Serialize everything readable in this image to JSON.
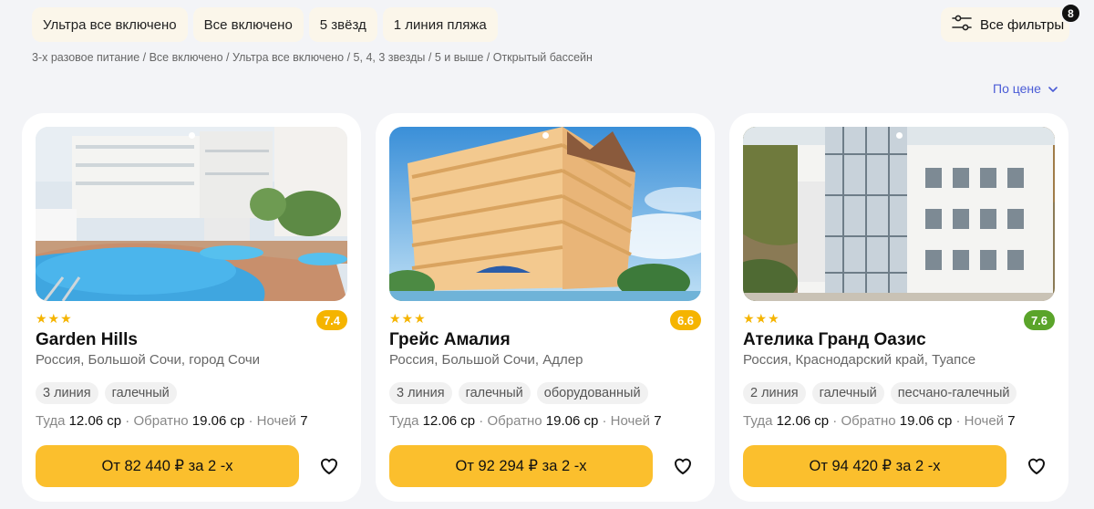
{
  "chips": [
    "Ультра все включено",
    "Все включено",
    "5 звёзд",
    "1 линия пляжа"
  ],
  "filters": {
    "label": "Все фильтры",
    "count": "8"
  },
  "breadcrumb": "3-х разовое питание / Все включено / Ультра все включено / 5, 4, 3 звезды / 5 и выше / Открытый бассейн",
  "sort": {
    "label": "По цене"
  },
  "dates_labels": {
    "there": "Туда",
    "back": "Обратно",
    "nights": "Ночей",
    "sep": " · "
  },
  "colors": {
    "accent": "#fbbf2d",
    "star": "#f5b400",
    "link": "#4a5bd6"
  },
  "hotels": [
    {
      "stars": "★★★",
      "rating": "7.4",
      "rating_color": "#f5b400",
      "name": "Garden Hills",
      "location": "Россия, Большой Сочи, город Сочи",
      "tags": [
        "3 линия",
        "галечный"
      ],
      "date_there": "12.06 ср",
      "date_back": "19.06 ср",
      "nights": "7",
      "price": "От 82 440 ₽ за 2 -х"
    },
    {
      "stars": "★★★",
      "rating": "6.6",
      "rating_color": "#f5b400",
      "name": "Грейс Амалия",
      "location": "Россия, Большой Сочи, Адлер",
      "tags": [
        "3 линия",
        "галечный",
        "оборудованный"
      ],
      "date_there": "12.06 ср",
      "date_back": "19.06 ср",
      "nights": "7",
      "price": "От 92 294 ₽ за 2 -х"
    },
    {
      "stars": "★★★",
      "rating": "7.6",
      "rating_color": "#5aa42a",
      "name": "Ателика Гранд Оазис",
      "location": "Россия, Краснодарский край, Туапсе",
      "tags": [
        "2 линия",
        "галечный",
        "песчано-галечный"
      ],
      "date_there": "12.06 ср",
      "date_back": "19.06 ср",
      "nights": "7",
      "price": "От 94 420 ₽ за 2 -х"
    }
  ]
}
